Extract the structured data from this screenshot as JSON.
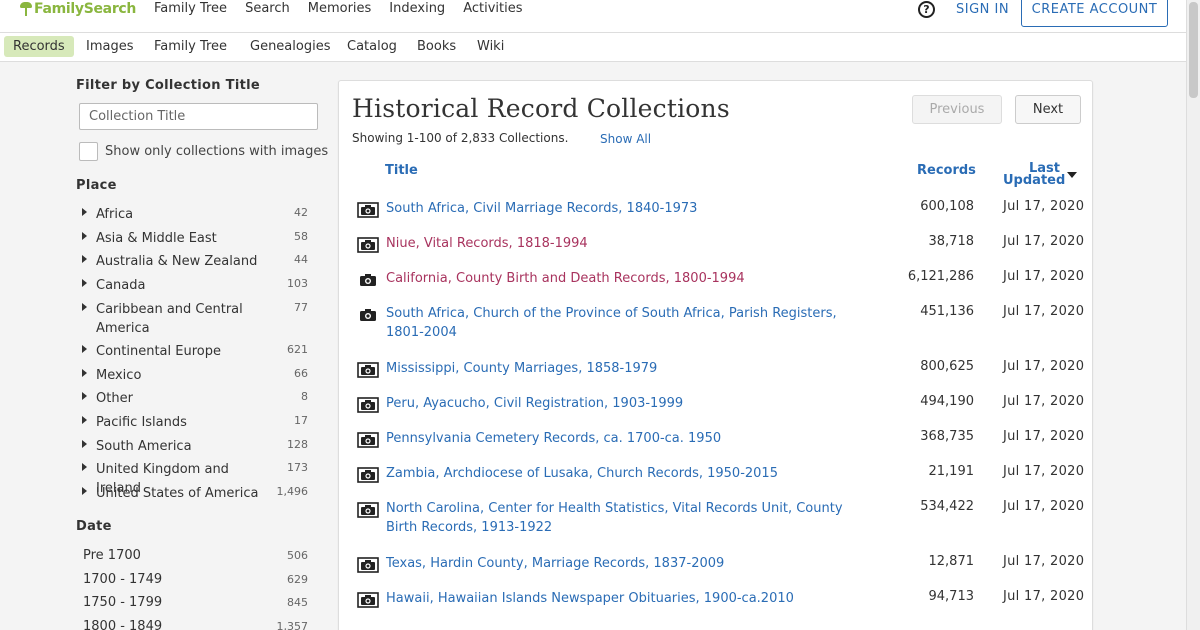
{
  "header": {
    "logo_text": "FamilySearch",
    "nav": [
      "Family Tree",
      "Search",
      "Memories",
      "Indexing",
      "Activities"
    ],
    "help_label": "?",
    "signin_label": "SIGN IN",
    "create_account_label": "CREATE ACCOUNT"
  },
  "subnav": {
    "items": [
      "Records",
      "Images",
      "Family Tree",
      "Genealogies",
      "Catalog",
      "Books",
      "Wiki"
    ],
    "active": "Records"
  },
  "sidebar": {
    "filter_heading": "Filter by Collection Title",
    "filter_placeholder": "Collection Title",
    "images_only_label": "Show only collections with images",
    "place_heading": "Place",
    "places": [
      {
        "name": "Africa",
        "count": "42"
      },
      {
        "name": "Asia & Middle East",
        "count": "58"
      },
      {
        "name": "Australia & New Zealand",
        "count": "44"
      },
      {
        "name": "Canada",
        "count": "103"
      },
      {
        "name": "Caribbean and Central America",
        "count": "77"
      },
      {
        "name": "Continental Europe",
        "count": "621"
      },
      {
        "name": "Mexico",
        "count": "66"
      },
      {
        "name": "Other",
        "count": "8"
      },
      {
        "name": "Pacific Islands",
        "count": "17"
      },
      {
        "name": "South America",
        "count": "128"
      },
      {
        "name": "United Kingdom and Ireland",
        "count": "173"
      },
      {
        "name": "United States of America",
        "count": "1,496"
      }
    ],
    "date_heading": "Date",
    "dates": [
      {
        "name": "Pre 1700",
        "count": "506"
      },
      {
        "name": "1700 - 1749",
        "count": "629"
      },
      {
        "name": "1750 - 1799",
        "count": "845"
      },
      {
        "name": "1800 - 1849",
        "count": "1,357"
      }
    ]
  },
  "main": {
    "title": "Historical Record Collections",
    "showing": "Showing 1-100 of 2,833 Collections.",
    "show_all": "Show All",
    "prev_label": "Previous",
    "next_label": "Next",
    "columns": {
      "title": "Title",
      "records": "Records",
      "last_updated_1": "Last",
      "last_updated_2": "Updated"
    },
    "rows": [
      {
        "title": "South Africa, Civil Marriage Records, 1840-1973",
        "records": "600,108",
        "updated": "Jul 17, 2020",
        "icon": "camera-framed-icon",
        "visited": false
      },
      {
        "title": "Niue, Vital Records, 1818-1994",
        "records": "38,718",
        "updated": "Jul 17, 2020",
        "icon": "camera-framed-icon",
        "visited": true
      },
      {
        "title": "California, County Birth and Death Records, 1800-1994",
        "records": "6,121,286",
        "updated": "Jul 17, 2020",
        "icon": "camera-icon",
        "visited": true
      },
      {
        "title": "South Africa, Church of the Province of South Africa, Parish Registers, 1801-2004",
        "records": "451,136",
        "updated": "Jul 17, 2020",
        "icon": "camera-icon",
        "visited": false
      },
      {
        "title": "Mississippi, County Marriages, 1858-1979",
        "records": "800,625",
        "updated": "Jul 17, 2020",
        "icon": "camera-framed-icon",
        "visited": false
      },
      {
        "title": "Peru, Ayacucho, Civil Registration, 1903-1999",
        "records": "494,190",
        "updated": "Jul 17, 2020",
        "icon": "camera-framed-icon",
        "visited": false
      },
      {
        "title": "Pennsylvania Cemetery Records, ca. 1700-ca. 1950",
        "records": "368,735",
        "updated": "Jul 17, 2020",
        "icon": "camera-framed-icon",
        "visited": false
      },
      {
        "title": "Zambia, Archdiocese of Lusaka, Church Records, 1950-2015",
        "records": "21,191",
        "updated": "Jul 17, 2020",
        "icon": "camera-framed-icon",
        "visited": false
      },
      {
        "title": "North Carolina, Center for Health Statistics, Vital Records Unit, County Birth Records, 1913-1922",
        "records": "534,422",
        "updated": "Jul 17, 2020",
        "icon": "camera-framed-icon",
        "visited": false
      },
      {
        "title": "Texas, Hardin County, Marriage Records, 1837-2009",
        "records": "12,871",
        "updated": "Jul 17, 2020",
        "icon": "camera-framed-icon",
        "visited": false
      },
      {
        "title": "Hawaii, Hawaiian Islands Newspaper Obituaries, 1900-ca.2010",
        "records": "94,713",
        "updated": "Jul 17, 2020",
        "icon": "camera-framed-icon",
        "visited": false
      }
    ]
  }
}
